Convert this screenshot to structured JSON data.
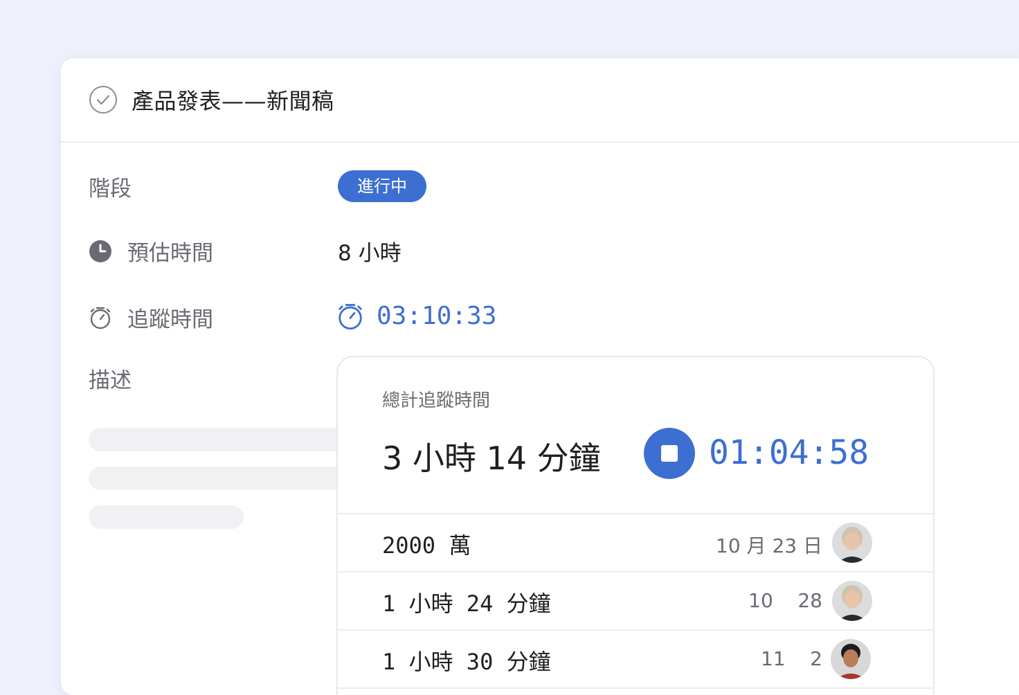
{
  "task": {
    "title": "產品發表——新聞稿"
  },
  "fields": {
    "stage_label": "階段",
    "stage_value": "進行中",
    "estimate_label": "預估時間",
    "estimate_value": "8 小時",
    "tracked_label": "追蹤時間",
    "tracked_value": "03:10:33",
    "description_label": "描述"
  },
  "popup": {
    "subtitle": "總計追蹤時間",
    "total": "3 小時 14 分鐘",
    "running_timer": "01:04:58",
    "entries": [
      {
        "duration": "2000 萬",
        "date": "10 月 23 日",
        "avatar": "avatar-woman-grey-hair"
      },
      {
        "duration": "1 小時 24 分鐘",
        "date": "10    28",
        "avatar": "avatar-woman-grey-hair"
      },
      {
        "duration": "1 小時 30 分鐘",
        "date": "11    2",
        "avatar": "avatar-man-dark-hair"
      }
    ]
  },
  "colors": {
    "accent": "#3c6fd1",
    "background": "#eef0fc"
  }
}
